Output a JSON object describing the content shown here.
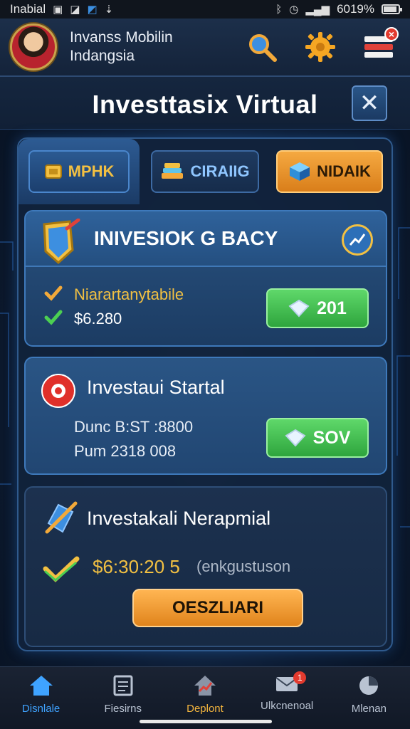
{
  "status_bar": {
    "carrier": "Inabial",
    "battery_text": "6019%",
    "battery_level": 0.9
  },
  "header": {
    "app_name": "Invanss Mobilin Indangsia",
    "icons": [
      "search-icon",
      "gear-icon",
      "menu-icon"
    ],
    "menu_badge": "×"
  },
  "title_bar": {
    "title": "Investtasix Virtual",
    "close_label": "✕"
  },
  "tabs": [
    {
      "label": "MPHK",
      "icon": "gold-icon"
    },
    {
      "label": "CIRAIIG",
      "icon": "stack-icon"
    },
    {
      "label": "NIDAIK",
      "icon": "cube-icon"
    }
  ],
  "cards": [
    {
      "title": "INIVESIOK G BACY",
      "line1": "Niarartanytabile",
      "line2": "$6.280",
      "line2_value": "280",
      "button": "201"
    },
    {
      "title": "Investaui Startal",
      "line1": "Dunc B:ST :8800",
      "line2": "Pum 2318 008",
      "button": "SOV"
    },
    {
      "title": "Investakali Nerapmial",
      "amount": "$6:30:20 5",
      "note": "(enkgustuson",
      "button": "OESZLIARI"
    }
  ],
  "bottom_nav": [
    {
      "label": "Disnlale",
      "icon": "home-icon"
    },
    {
      "label": "Fiesirns",
      "icon": "document-icon"
    },
    {
      "label": "Deplont",
      "icon": "chart-up-icon"
    },
    {
      "label": "Ulkcnenoal",
      "icon": "mail-icon",
      "badge": "1"
    },
    {
      "label": "Mlenan",
      "icon": "pie-chart-icon"
    }
  ],
  "colors": {
    "accent_blue": "#3fa3ff",
    "gold": "#f2c042",
    "green": "#3fbf4c",
    "orange": "#f5a941",
    "panel": "#1c3c63"
  }
}
